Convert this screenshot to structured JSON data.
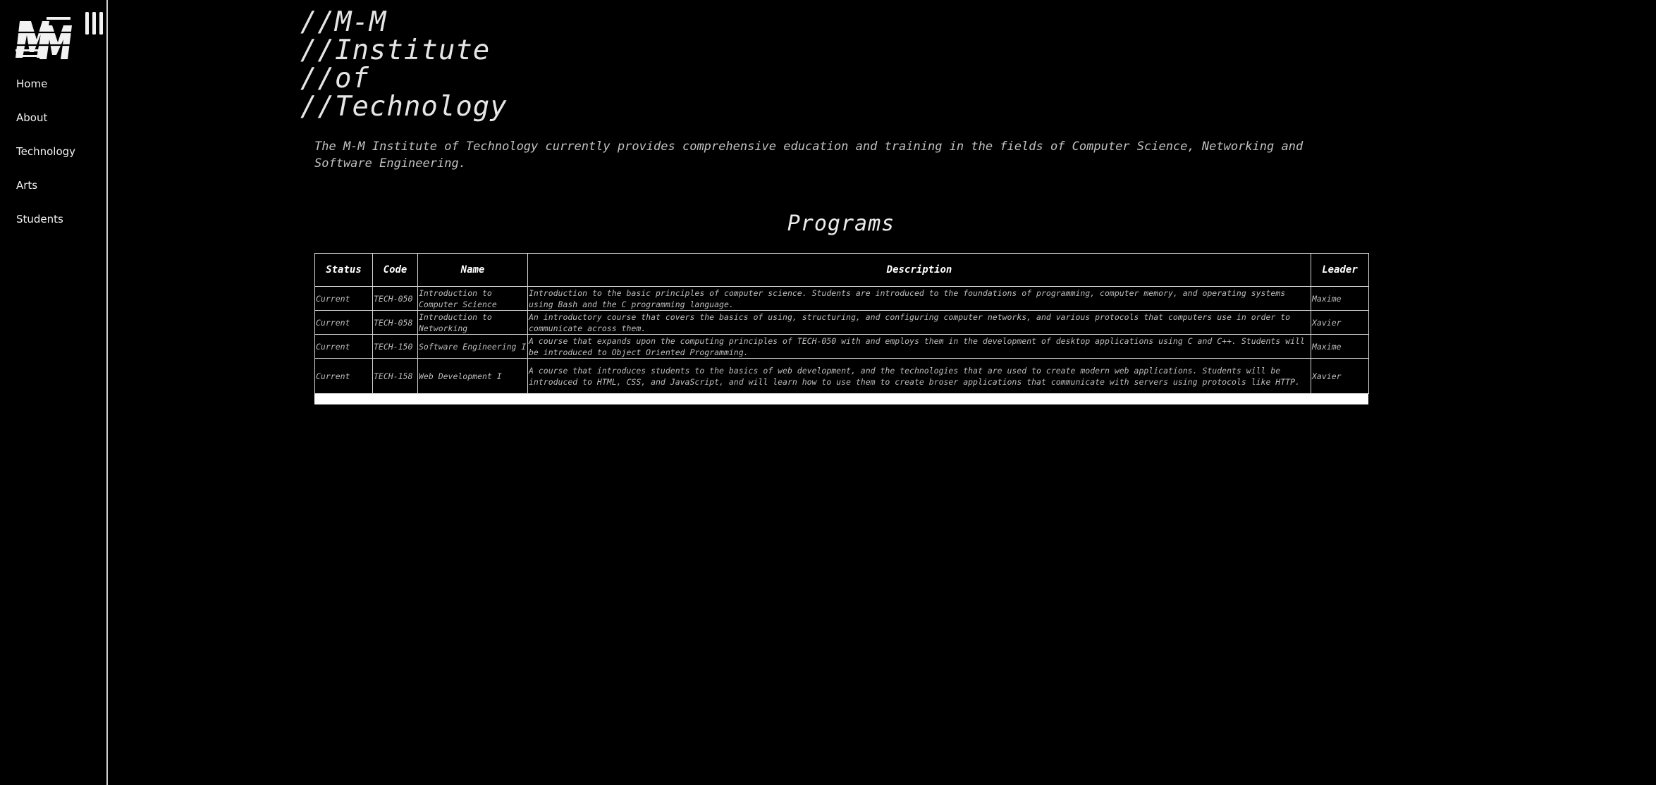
{
  "sidebar": {
    "logo_text": "M-M",
    "menu_icon": "hamburger-icon",
    "nav": [
      "Home",
      "About",
      "Technology",
      "Arts",
      "Students"
    ]
  },
  "header": {
    "title_lines": [
      "//M-M",
      "//Institute",
      "//of",
      "//Technology"
    ]
  },
  "intro": "The M-M Institute of Technology currently provides comprehensive education and training in the fields of Computer Science, Networking and Software Engineering.",
  "programs": {
    "heading": "Programs",
    "columns": [
      "Status",
      "Code",
      "Name",
      "Description",
      "Leader"
    ],
    "rows": [
      {
        "status": "Current",
        "code": "TECH-050",
        "name": "Introduction to Computer Science",
        "description": "Introduction to the basic principles of computer science. Students are introduced to the foundations of programming, computer memory, and operating systems using Bash and the C programming language.",
        "leader": "Maxime"
      },
      {
        "status": "Current",
        "code": "TECH-058",
        "name": "Introduction to Networking",
        "description": "An introductory course that covers the basics of using, structuring, and configuring computer networks, and various protocols that computers use in order to communicate across them.",
        "leader": "Xavier"
      },
      {
        "status": "Current",
        "code": "TECH-150",
        "name": "Software Engineering I",
        "description": "A course that expands upon the computing principles of TECH-050 with and employs them in the development of desktop applications using C and C++. Students will be introduced to Object Oriented Programming.",
        "leader": "Maxime"
      },
      {
        "status": "Current",
        "code": "TECH-158",
        "name": "Web Development I",
        "description": "A course that introduces students to the basics of web development, and the technologies that are used to create modern web applications. Students will be introduced to HTML, CSS, and JavaScript, and will learn how to use them to create broser applications that communicate with servers using protocols like HTTP.",
        "leader": "Xavier"
      }
    ]
  }
}
